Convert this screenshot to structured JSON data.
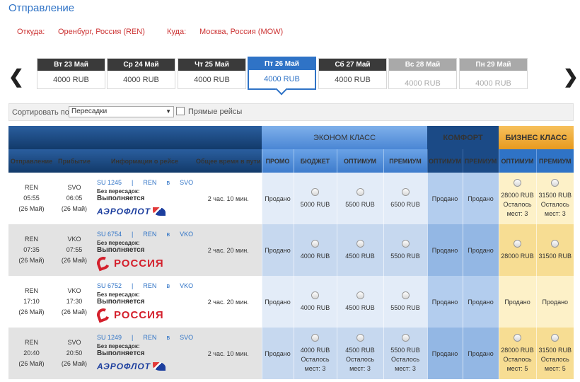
{
  "page": {
    "title": "Отправление"
  },
  "route": {
    "from_label": "Откуда:",
    "from_value": "Оренбург, Россия (REN)",
    "to_label": "Куда:",
    "to_value": "Москва, Россия (MOW)"
  },
  "dates": [
    {
      "label": "Вт 23 Май",
      "price": "4000 RUB",
      "state": "normal"
    },
    {
      "label": "Ср 24 Май",
      "price": "4000 RUB",
      "state": "normal"
    },
    {
      "label": "Чт 25 Май",
      "price": "4000 RUB",
      "state": "normal"
    },
    {
      "label": "Пт 26 Май",
      "price": "4000 RUB",
      "state": "selected"
    },
    {
      "label": "Сб 27 Май",
      "price": "4000 RUB",
      "state": "normal"
    },
    {
      "label": "Вс 28 Май",
      "price": "4000 RUB",
      "state": "disabled"
    },
    {
      "label": "Пн 29 Май",
      "price": "4000 RUB",
      "state": "disabled"
    }
  ],
  "sort": {
    "label": "Сортировать по",
    "selected": "Пересадки",
    "direct_label": "Прямые рейсы",
    "direct_checked": false
  },
  "table": {
    "headers": {
      "departure": "Отправление",
      "arrival": "Прибытие",
      "info": "Информация о рейсе",
      "duration": "Общее время в пути"
    },
    "classes": {
      "economy": {
        "label": "ЭКОНОМ КЛАСС",
        "subs": [
          "ПРОМО",
          "БЮДЖЕТ",
          "ОПТИМУМ",
          "ПРЕМИУМ"
        ]
      },
      "comfort": {
        "label": "КОМФОРТ",
        "subs": [
          "ОПТИМУМ",
          "ПРЕМИУМ"
        ]
      },
      "business": {
        "label": "БИЗНЕС КЛАСС",
        "subs": [
          "ОПТИМУМ",
          "ПРЕМИУМ"
        ]
      }
    },
    "rows": [
      {
        "dep_code": "REN",
        "dep_time": "05:55",
        "dep_date": "(26 Май)",
        "arr_code": "SVO",
        "arr_time": "06:05",
        "arr_date": "(26 Май)",
        "flight": "SU 1245",
        "sep": "|",
        "from": "REN",
        "via": "в",
        "to": "SVO",
        "stops": "Без пересадок:",
        "status": "Выполняется",
        "airline": "aeroflot",
        "airline_name": "АЭРОФЛОТ",
        "duration": "2 час. 10 мин.",
        "fares": [
          {
            "cls": "econ",
            "sold": true,
            "text": "Продано"
          },
          {
            "cls": "econ",
            "sold": false,
            "price": "5000 RUB"
          },
          {
            "cls": "econ",
            "sold": false,
            "price": "5500 RUB"
          },
          {
            "cls": "econ",
            "sold": false,
            "price": "6500 RUB"
          },
          {
            "cls": "comf",
            "sold": true,
            "text": "Продано"
          },
          {
            "cls": "comf",
            "sold": true,
            "text": "Продано"
          },
          {
            "cls": "bus",
            "sold": false,
            "price": "28000 RUB",
            "seats_label": "Осталось",
            "seats": "мест: 3"
          },
          {
            "cls": "bus",
            "sold": false,
            "price": "31500 RUB",
            "seats_label": "Осталось",
            "seats": "мест: 3"
          }
        ]
      },
      {
        "dep_code": "REN",
        "dep_time": "07:35",
        "dep_date": "(26 Май)",
        "arr_code": "VKO",
        "arr_time": "07:55",
        "arr_date": "(26 Май)",
        "flight": "SU 6754",
        "sep": "|",
        "from": "REN",
        "via": "в",
        "to": "VKO",
        "stops": "Без пересадок:",
        "status": "Выполняется",
        "airline": "rossiya",
        "airline_name": "РОССИЯ",
        "duration": "2 час. 20 мин.",
        "fares": [
          {
            "cls": "econ",
            "sold": true,
            "text": "Продано"
          },
          {
            "cls": "econ",
            "sold": false,
            "price": "4000 RUB"
          },
          {
            "cls": "econ",
            "sold": false,
            "price": "4500 RUB"
          },
          {
            "cls": "econ",
            "sold": false,
            "price": "5500 RUB"
          },
          {
            "cls": "comf",
            "sold": true,
            "text": "Продано"
          },
          {
            "cls": "comf",
            "sold": true,
            "text": "Продано"
          },
          {
            "cls": "bus",
            "sold": false,
            "price": "28000 RUB"
          },
          {
            "cls": "bus",
            "sold": false,
            "price": "31500 RUB"
          }
        ]
      },
      {
        "dep_code": "REN",
        "dep_time": "17:10",
        "dep_date": "(26 Май)",
        "arr_code": "VKO",
        "arr_time": "17:30",
        "arr_date": "(26 Май)",
        "flight": "SU 6752",
        "sep": "|",
        "from": "REN",
        "via": "в",
        "to": "VKO",
        "stops": "Без пересадок:",
        "status": "Выполняется",
        "airline": "rossiya",
        "airline_name": "РОССИЯ",
        "duration": "2 час. 20 мин.",
        "fares": [
          {
            "cls": "econ",
            "sold": true,
            "text": "Продано"
          },
          {
            "cls": "econ",
            "sold": false,
            "price": "4000 RUB"
          },
          {
            "cls": "econ",
            "sold": false,
            "price": "4500 RUB"
          },
          {
            "cls": "econ",
            "sold": false,
            "price": "5500 RUB"
          },
          {
            "cls": "comf",
            "sold": true,
            "text": "Продано"
          },
          {
            "cls": "comf",
            "sold": true,
            "text": "Продано"
          },
          {
            "cls": "bus",
            "sold": true,
            "text": "Продано"
          },
          {
            "cls": "bus",
            "sold": true,
            "text": "Продано"
          }
        ]
      },
      {
        "dep_code": "REN",
        "dep_time": "20:40",
        "dep_date": "(26 Май)",
        "arr_code": "SVO",
        "arr_time": "20:50",
        "arr_date": "(26 Май)",
        "flight": "SU 1249",
        "sep": "|",
        "from": "REN",
        "via": "в",
        "to": "SVO",
        "stops": "Без пересадок:",
        "status": "Выполняется",
        "airline": "aeroflot",
        "airline_name": "АЭРОФЛОТ",
        "duration": "2 час. 10 мин.",
        "fares": [
          {
            "cls": "econ",
            "sold": true,
            "text": "Продано"
          },
          {
            "cls": "econ",
            "sold": false,
            "price": "4000 RUB",
            "seats_label": "Осталось",
            "seats": "мест: 3"
          },
          {
            "cls": "econ",
            "sold": false,
            "price": "4500 RUB",
            "seats_label": "Осталось",
            "seats": "мест: 3"
          },
          {
            "cls": "econ",
            "sold": false,
            "price": "5500 RUB",
            "seats_label": "Осталось",
            "seats": "мест: 3"
          },
          {
            "cls": "comf",
            "sold": true,
            "text": "Продано"
          },
          {
            "cls": "comf",
            "sold": true,
            "text": "Продано"
          },
          {
            "cls": "bus",
            "sold": false,
            "price": "28000 RUB",
            "seats_label": "Осталось",
            "seats": "мест: 5"
          },
          {
            "cls": "bus",
            "sold": false,
            "price": "31500 RUB",
            "seats_label": "Осталось",
            "seats": "мест: 5"
          }
        ]
      }
    ]
  },
  "icons": {
    "prev": "chevron-left-icon",
    "next": "chevron-right-icon",
    "dropdown": "caret-down-icon",
    "radio": "radio-button-icon"
  },
  "colors": {
    "accent": "#2f73c6",
    "route_text": "#cc3333",
    "business": "#e79a1f",
    "comfort": "#1b4a86"
  }
}
